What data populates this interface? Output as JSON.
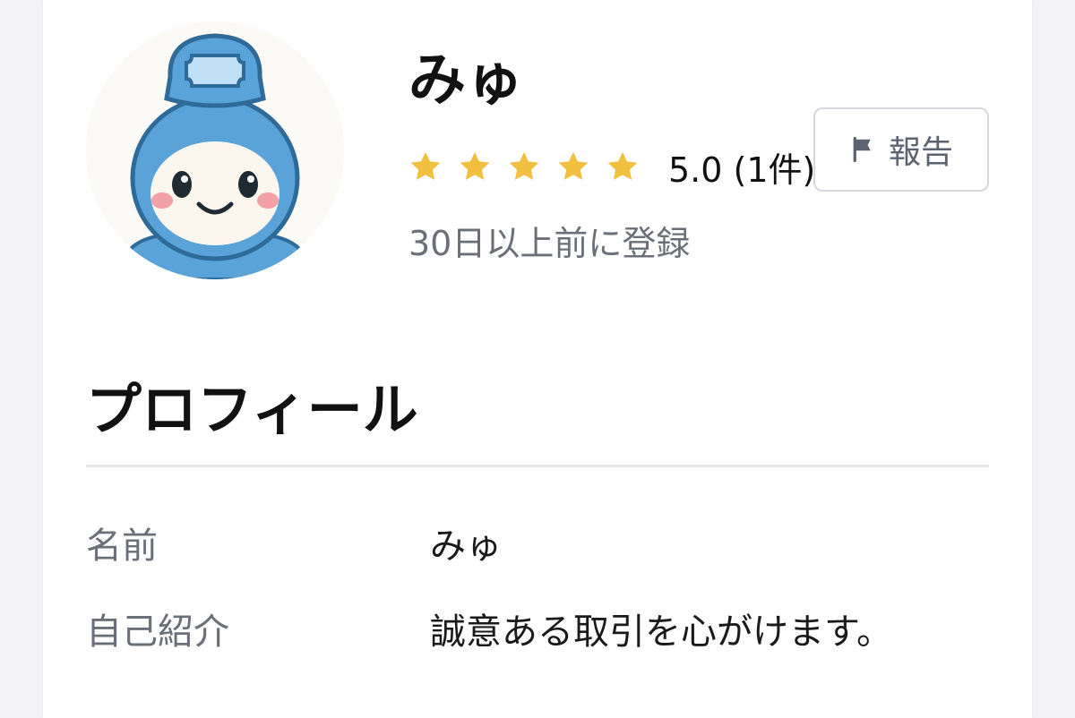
{
  "profile": {
    "user_name": "みゅ",
    "rating": {
      "stars": 5,
      "max_stars": 5,
      "value_text": "5.0 (1件)"
    },
    "registered_text": "30日以上前に登録",
    "report_label": "報告"
  },
  "section": {
    "title": "プロフィール"
  },
  "fields": {
    "name": {
      "label": "名前",
      "value": "みゅ"
    },
    "bio": {
      "label": "自己紹介",
      "value": "誠意ある取引を心がけます。"
    }
  },
  "colors": {
    "star": "#f2c040",
    "text_primary": "#111111",
    "text_secondary": "#6b6f78",
    "border": "#d6d8dd",
    "avatar_blue": "#5aa3d8"
  },
  "icons": {
    "avatar": "mascot-avatar",
    "star": "star-icon",
    "report": "flag-icon"
  }
}
